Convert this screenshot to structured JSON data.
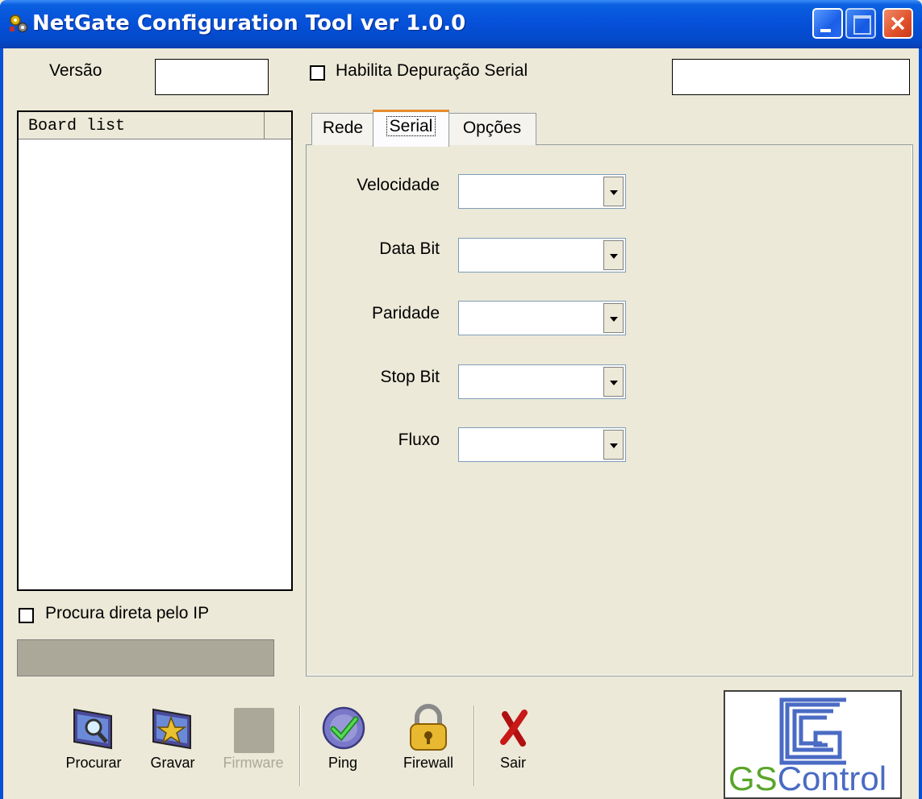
{
  "window": {
    "title": "NetGate Configuration Tool ver 1.0.0"
  },
  "header": {
    "version_label": "Versão",
    "version_value": "",
    "serial_debug_label": "Habilita Depuração Serial",
    "serial_debug_checked": false,
    "status_value": ""
  },
  "board_list": {
    "header": "Board list",
    "items": []
  },
  "direct_ip": {
    "label": "Procura direta pelo IP",
    "checked": false,
    "value": ""
  },
  "tabs": [
    {
      "label": "Rede",
      "active": false
    },
    {
      "label": "Serial",
      "active": true
    },
    {
      "label": "Opções",
      "active": false
    }
  ],
  "serial": {
    "fields": [
      {
        "label": "Velocidade",
        "value": ""
      },
      {
        "label": "Data Bit",
        "value": ""
      },
      {
        "label": "Paridade",
        "value": ""
      },
      {
        "label": "Stop Bit",
        "value": ""
      },
      {
        "label": "Fluxo",
        "value": ""
      }
    ]
  },
  "toolbar": {
    "search_label": "Procurar",
    "write_label": "Gravar",
    "firmware_label": "Firmware",
    "firmware_enabled": false,
    "ping_label": "Ping",
    "firewall_label": "Firewall",
    "exit_label": "Sair"
  },
  "logo": {
    "text_gs": "GS",
    "text_control": "Control"
  },
  "colors": {
    "titlebar": "#0550d8",
    "face": "#ece9d8",
    "logo_blue": "#4a6bc4",
    "logo_green": "#5aa52a"
  }
}
